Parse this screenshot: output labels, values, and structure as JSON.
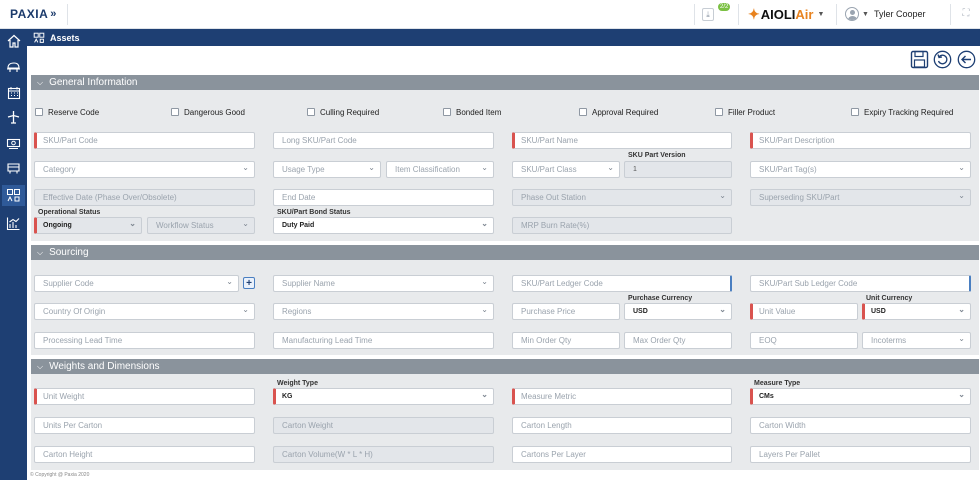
{
  "app": {
    "logo": "PAXIA",
    "download_badge": "2/2",
    "brand_part1": "AIOLI",
    "brand_part2": "Air",
    "user_name": "Tyler Cooper",
    "footer": "© Copyright @ Paxia 2020"
  },
  "colors": {
    "sidebar": "#1e3f73",
    "section": "#8a939c",
    "required": "#d9534f",
    "brand_orange": "#e8821e"
  },
  "page": {
    "title": "Assets"
  },
  "sidebar": {
    "icons": [
      "home-icon",
      "aircraft-icon",
      "calendar-icon",
      "plane-icon",
      "money-icon",
      "truck-icon",
      "assets-icon",
      "report-chart-icon"
    ],
    "active": "assets-icon"
  },
  "actions": {
    "icons": [
      "save-icon",
      "refresh-icon",
      "back-arrow-icon"
    ]
  },
  "sections": {
    "general": "General Information",
    "sourcing": "Sourcing",
    "weights": "Weights and Dimensions"
  },
  "checkboxes": [
    "Reserve Code",
    "Dangerous Good",
    "Culling Required",
    "Bonded Item",
    "Approval Required",
    "Filler Product",
    "Expiry Tracking Required"
  ],
  "general": {
    "sku_part_code": "SKU/Part Code",
    "long_sku_code": "Long SKU/Part Code",
    "sku_part_name": "SKU/Part Name",
    "sku_part_description": "SKU/Part Description",
    "category": "Category",
    "usage_type": "Usage Type",
    "item_classification": "Item Classification",
    "sku_part_class": "SKU/Part Class",
    "sku_part_version_label": "SKU Part Version",
    "sku_part_version_value": "1",
    "sku_part_tags": "SKU/Part Tag(s)",
    "effective_date": "Effective Date (Phase Over/Obsolete)",
    "end_date": "End Date",
    "phase_out_station": "Phase Out Station",
    "superseding_sku": "Superseding SKU/Part",
    "operational_status_label": "Operational Status",
    "operational_status_value": "Ongoing",
    "workflow_status": "Workflow Status",
    "bond_status_label": "SKU/Part Bond Status",
    "bond_status_value": "Duty Paid",
    "mrp_burn_rate": "MRP Burn Rate(%)"
  },
  "sourcing": {
    "supplier_code": "Supplier Code",
    "supplier_name": "Supplier Name",
    "ledger_code": "SKU/Part Ledger Code",
    "sub_ledger_code": "SKU/Part Sub Ledger Code",
    "country_of_origin": "Country Of Origin",
    "regions": "Regions",
    "purchase_price": "Purchase Price",
    "purchase_currency_label": "Purchase Currency",
    "purchase_currency_value": "USD",
    "unit_value": "Unit Value",
    "unit_currency_label": "Unit Currency",
    "unit_currency_value": "USD",
    "processing_lead_time": "Processing Lead Time",
    "manufacturing_lead_time": "Manufacturing Lead Time",
    "min_order_qty": "Min Order Qty",
    "max_order_qty": "Max Order Qty",
    "eoq": "EOQ",
    "incoterms": "Incoterms"
  },
  "weights": {
    "unit_weight": "Unit Weight",
    "weight_type_label": "Weight Type",
    "weight_type_value": "KG",
    "measure_metric": "Measure Metric",
    "measure_type_label": "Measure Type",
    "measure_type_value": "CMs",
    "units_per_carton": "Units Per Carton",
    "carton_weight": "Carton Weight",
    "carton_length": "Carton Length",
    "carton_width": "Carton Width",
    "carton_height": "Carton Height",
    "carton_volume": "Carton Volume(W * L * H)",
    "cartons_per_layer": "Cartons Per Layer",
    "layers_per_pallet": "Layers Per Pallet"
  }
}
